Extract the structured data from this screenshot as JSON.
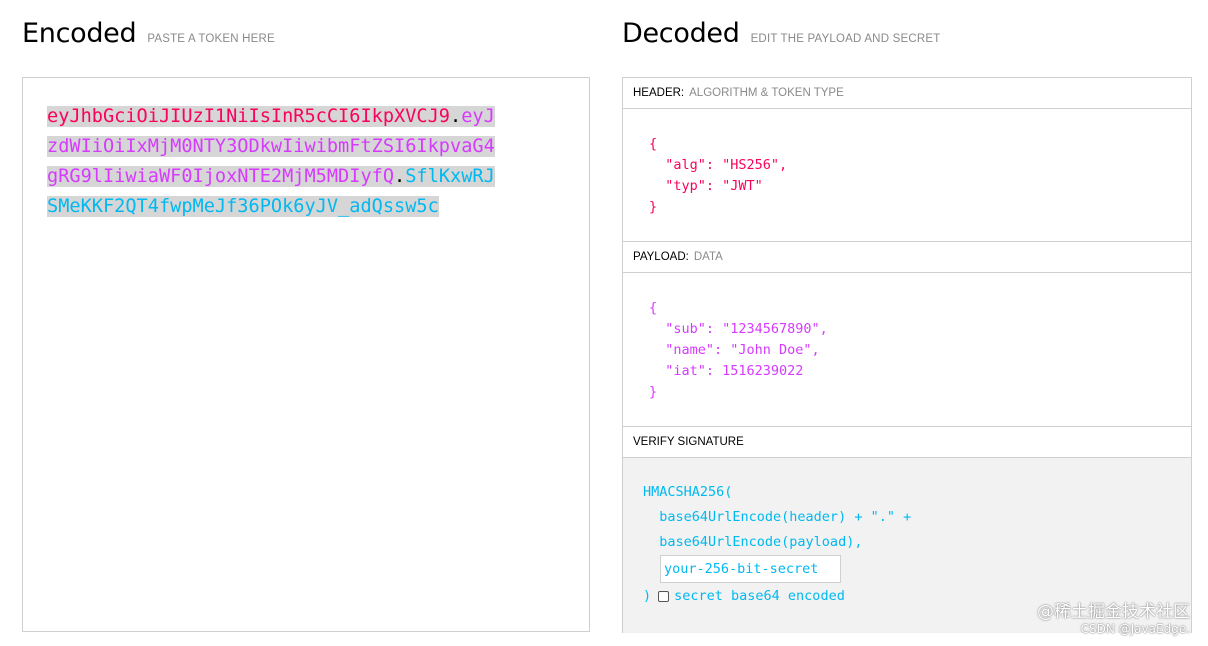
{
  "encoded": {
    "title": "Encoded",
    "subtitle": "PASTE A TOKEN HERE",
    "token_header": "eyJhbGciOiJIUzI1NiIsInR5cCI6IkpXVCJ9",
    "dot1": ".",
    "token_payload": "eyJzdWIiOiIxMjM0NTY3ODkwIiwibmFtZSI6IkpvaG4gRG9lIiwiaWF0IjoxNTE2MjM5MDIyfQ",
    "dot2": ".",
    "token_signature": "SflKxwRJSMeKKF2QT4fwpMeJf36POk6yJV_adQssw5c"
  },
  "decoded": {
    "title": "Decoded",
    "subtitle": "EDIT THE PAYLOAD AND SECRET",
    "header_section": {
      "label": "HEADER:",
      "sublabel": "ALGORITHM & TOKEN TYPE",
      "json": "{\n  \"alg\": \"HS256\",\n  \"typ\": \"JWT\"\n}"
    },
    "payload_section": {
      "label": "PAYLOAD:",
      "sublabel": "DATA",
      "json": "{\n  \"sub\": \"1234567890\",\n  \"name\": \"John Doe\",\n  \"iat\": 1516239022\n}"
    },
    "verify_section": {
      "label": "VERIFY SIGNATURE",
      "code": "HMACSHA256(\n  base64UrlEncode(header) + \".\" +\n  base64UrlEncode(payload),",
      "secret_value": "your-256-bit-secret",
      "closing": ")",
      "checkbox_label": "secret base64 encoded"
    }
  },
  "watermark": {
    "line1": "@稀土掘金技术社区",
    "line2": "CSDN @JavaEdge."
  },
  "colors": {
    "header": "#fb015b",
    "payload": "#d63aff",
    "signature": "#00b9f1"
  }
}
